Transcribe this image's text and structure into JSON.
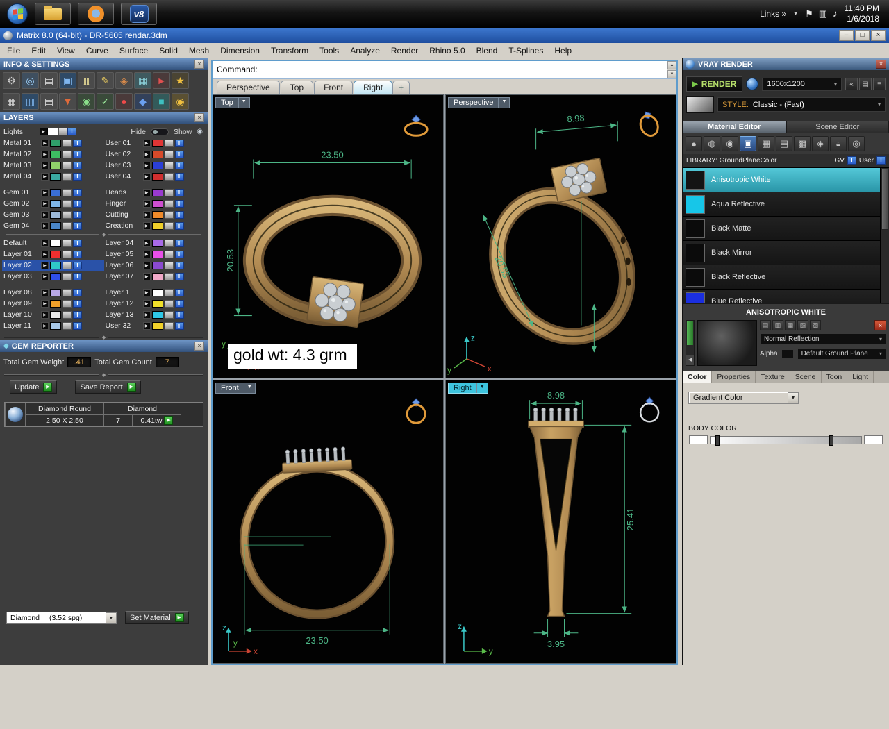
{
  "ui": {
    "chevron_down": "▼",
    "caret_small": "▾",
    "scroll_up": "▲",
    "scroll_down": "▼",
    "layer_arrow": "▶",
    "material_badge": "I",
    "go_arrow": "▶",
    "divider_grip": "◆",
    "links_chevron": "»",
    "close_glyph": "×",
    "eye_glyph": "◉",
    "back_arrow": "◀"
  },
  "taskbar": {
    "links_label": "Links",
    "time": "11:40 PM",
    "date": "1/6/2018",
    "v8_label": "v8",
    "tray_icons": [
      {
        "name": "flag-icon",
        "glyph": "⚑"
      },
      {
        "name": "network-icon",
        "glyph": "▥"
      },
      {
        "name": "volume-icon",
        "glyph": "♪"
      }
    ]
  },
  "window": {
    "title": "Matrix 8.0 (64-bit) - DR-5605 rendar.3dm",
    "btn_min": "–",
    "btn_max": "□",
    "btn_close": "×"
  },
  "menubar": {
    "items": [
      "File",
      "Edit",
      "View",
      "Curve",
      "Surface",
      "Solid",
      "Mesh",
      "Dimension",
      "Transform",
      "Tools",
      "Analyze",
      "Render",
      "Rhino 5.0",
      "Blend",
      "T-Splines",
      "Help"
    ]
  },
  "command": {
    "prompt": "Command:"
  },
  "viewport_tabs": {
    "items": [
      {
        "label": "Perspective"
      },
      {
        "label": "Top"
      },
      {
        "label": "Front"
      },
      {
        "label": "Right",
        "active": true
      }
    ],
    "add_label": "+"
  },
  "info_settings": {
    "title": "INFO & SETTINGS",
    "icons_row1": [
      {
        "name": "gear-icon",
        "glyph": "⚙",
        "fg": "#d0d0d0",
        "bg": "#4a4a4a"
      },
      {
        "name": "search-icon",
        "glyph": "◎",
        "fg": "#9fd4ff",
        "bg": "#3f4f5f"
      },
      {
        "name": "print-icon",
        "glyph": "▤",
        "fg": "#e0e0e0",
        "bg": "#4a4a4a"
      },
      {
        "name": "panels-icon",
        "glyph": "▣",
        "fg": "#7fb6ef",
        "bg": "#2f4a66"
      },
      {
        "name": "notes-icon",
        "glyph": "▥",
        "fg": "#efe29a",
        "bg": "#4a4a4a"
      },
      {
        "name": "edit-pencil-icon",
        "glyph": "✎",
        "fg": "#f0d060",
        "bg": "#4a4a4a"
      },
      {
        "name": "history-icon",
        "glyph": "◈",
        "fg": "#d88a4a",
        "bg": "#4a4a4a"
      },
      {
        "name": "layout-icon",
        "glyph": "▦",
        "fg": "#8ad0d8",
        "bg": "#3f5a5f"
      },
      {
        "name": "play-icon",
        "glyph": "►",
        "fg": "#e05050",
        "bg": "#4a3a3a"
      },
      {
        "name": "star-icon",
        "glyph": "★",
        "fg": "#f0c040",
        "bg": "#4a4433"
      }
    ],
    "icons_row2": [
      {
        "name": "grid-icon",
        "glyph": "▦",
        "fg": "#cfcfcf",
        "bg": "#4a4a4a"
      },
      {
        "name": "viewport-icon",
        "glyph": "▥",
        "fg": "#7fb6ef",
        "bg": "#2f4a66"
      },
      {
        "name": "copy-icon",
        "glyph": "▤",
        "fg": "#e0e0e0",
        "bg": "#4a4a4a"
      },
      {
        "name": "filter-icon",
        "glyph": "▼",
        "fg": "#e06a3a",
        "bg": "#4a4a4a"
      },
      {
        "name": "gumball-icon",
        "glyph": "◉",
        "fg": "#8ae08a",
        "bg": "#3a4a3a"
      },
      {
        "name": "check-icon",
        "glyph": "✓",
        "fg": "#9fef9f",
        "bg": "#3a4a3a"
      },
      {
        "name": "record-icon",
        "glyph": "●",
        "fg": "#ef4a4a",
        "bg": "#4a3a3a"
      },
      {
        "name": "osnap-icon",
        "glyph": "◆",
        "fg": "#6a9fef",
        "bg": "#33415a"
      },
      {
        "name": "cplane-icon",
        "glyph": "■",
        "fg": "#3fc0c0",
        "bg": "#335a5a"
      },
      {
        "name": "sun-icon",
        "glyph": "◉",
        "fg": "#f0c040",
        "bg": "#5a5033"
      }
    ]
  },
  "layers": {
    "title": "LAYERS",
    "lights_name": "Lights",
    "hide_label": "Hide",
    "show_label": "Show",
    "rows_a": [
      {
        "l": {
          "name": "Metal 01",
          "color": "#2f9e6a"
        },
        "r": {
          "name": "User 01",
          "color": "#e03535"
        }
      },
      {
        "l": {
          "name": "Metal 02",
          "color": "#3dbd62"
        },
        "r": {
          "name": "User 02",
          "color": "#d84a2a"
        }
      },
      {
        "l": {
          "name": "Metal 03",
          "color": "#8fd06a"
        },
        "r": {
          "name": "User 03",
          "color": "#2b3fd8"
        }
      },
      {
        "l": {
          "name": "Metal 04",
          "color": "#3aa8a0"
        },
        "r": {
          "name": "User 04",
          "color": "#cf2f2f"
        }
      },
      {
        "l": {
          "name": "Gem 01",
          "color": "#3a6fd8"
        },
        "r": {
          "name": "Heads",
          "color": "#9a3ad0"
        }
      },
      {
        "l": {
          "name": "Gem 02",
          "color": "#7fb6e8"
        },
        "r": {
          "name": "Finger",
          "color": "#cf4fd0"
        }
      },
      {
        "l": {
          "name": "Gem 03",
          "color": "#9db9d8"
        },
        "r": {
          "name": "Cutting",
          "color": "#ef8a2a"
        }
      },
      {
        "l": {
          "name": "Gem 04",
          "color": "#4a86c8"
        },
        "r": {
          "name": "Creation",
          "color": "#efcf2a"
        }
      }
    ],
    "rows_b": [
      {
        "l": {
          "name": "Default",
          "color": "#ffffff"
        },
        "r": {
          "name": "Layer 04",
          "color": "#a86ae8"
        }
      },
      {
        "l": {
          "name": "Layer 01",
          "color": "#ef2f2f"
        },
        "r": {
          "name": "Layer 05",
          "color": "#e84fe8"
        }
      },
      {
        "l": {
          "name": "Layer 02",
          "color": "#2fc8c8",
          "selected": true
        },
        "r": {
          "name": "Layer 06",
          "color": "#8a4ad0"
        }
      },
      {
        "l": {
          "name": "Layer 03",
          "color": "#2f4fe8"
        },
        "r": {
          "name": "Layer 07",
          "color": "#f0a8c8"
        }
      },
      {
        "l": {
          "name": "Layer 08",
          "color": "#b8a8e8"
        },
        "r": {
          "name": "Layer 1",
          "color": "#ffffff"
        }
      },
      {
        "l": {
          "name": "Layer 09",
          "color": "#f0a02a"
        },
        "r": {
          "name": "Layer 12",
          "color": "#f0e02a"
        }
      },
      {
        "l": {
          "name": "Layer 10",
          "color": "#e8e8e8"
        },
        "r": {
          "name": "Layer 13",
          "color": "#2fc8e8"
        }
      },
      {
        "l": {
          "name": "Layer 11",
          "color": "#a8c8e8"
        },
        "r": {
          "name": "User 32",
          "color": "#f0d02a"
        }
      }
    ]
  },
  "gem_reporter": {
    "title": "GEM REPORTER",
    "weight_label": "Total Gem Weight",
    "weight_value": ".41",
    "count_label": "Total Gem Count",
    "count_value": "7",
    "update_label": "Update",
    "save_label": "Save Report",
    "col1": "Diamond Round",
    "col2": "Diamond",
    "cell_size": "2.50 X 2.50",
    "cell_count": "7",
    "cell_weight": "0.41tw",
    "material_value": "Diamond",
    "material_spg": "(3.52 spg)",
    "set_material_label": "Set Material"
  },
  "viewports": {
    "top": {
      "label": "Top",
      "dim_width": "23.50",
      "dim_height": "20.53",
      "annotation": "gold wt: 4.3 grm",
      "axis_x": "x",
      "axis_y": "y"
    },
    "perspective": {
      "label": "Perspective",
      "dim_width": "8.98",
      "dim_diag": "20.53",
      "axis_x": "x",
      "axis_y": "y",
      "axis_z": "z"
    },
    "front": {
      "label": "Front",
      "dim_width": "23.50",
      "axis_x": "x",
      "axis_y": "y",
      "axis_z": "z"
    },
    "right": {
      "label": "Right",
      "dim_width": "8.98",
      "dim_height": "25.41",
      "dim_bottom": "3.95",
      "axis_y": "y",
      "axis_z": "z"
    }
  },
  "vray": {
    "title": "VRAY RENDER",
    "render_label": "RENDER",
    "resolution": "1600x1200",
    "panel_buttons": [
      {
        "name": "dock-left-icon",
        "glyph": "«"
      },
      {
        "name": "panel-icon",
        "glyph": "▤"
      },
      {
        "name": "list-icon",
        "glyph": "≡"
      }
    ],
    "style_label": "STYLE:",
    "style_value": "Classic - (Fast)",
    "editor_tabs": [
      {
        "label": "Material Editor",
        "active": true
      },
      {
        "label": "Scene Editor"
      }
    ],
    "tool_icons": [
      {
        "name": "material-sphere-icon",
        "glyph": "●"
      },
      {
        "name": "material-shaded-icon",
        "glyph": "◍"
      },
      {
        "name": "material-ball-icon",
        "glyph": "◉"
      },
      {
        "name": "material-preview-icon",
        "glyph": "▣",
        "active": true
      },
      {
        "name": "checker-icon",
        "glyph": "▦"
      },
      {
        "name": "grid-texture-icon",
        "glyph": "▤"
      },
      {
        "name": "noise-icon",
        "glyph": "▩"
      },
      {
        "name": "wrap-icon",
        "glyph": "◈"
      },
      {
        "name": "bucket-icon",
        "glyph": "◒"
      },
      {
        "name": "bulb-icon",
        "glyph": "◎"
      }
    ],
    "library_label": "LIBRARY: GroundPlaneColor",
    "gv_label": "GV",
    "user_label": "User",
    "materials": [
      {
        "name": "Anisotropic White",
        "swatch": "#141414",
        "selected": true
      },
      {
        "name": "Aqua Reflective",
        "swatch": "#17c6e8"
      },
      {
        "name": "Black Matte",
        "swatch": "#0b0b0b"
      },
      {
        "name": "Black Mirror",
        "swatch": "#0b0b0b"
      },
      {
        "name": "Black Reflective",
        "swatch": "#0b0b0b"
      },
      {
        "name": "Blue Reflective",
        "swatch": "#1b2fe0"
      }
    ],
    "preview_title": "ANISOTROPIC WHITE",
    "preview_icons": [
      {
        "name": "save-material-icon",
        "glyph": "▤"
      },
      {
        "name": "load-material-icon",
        "glyph": "▥"
      },
      {
        "name": "copy-material-icon",
        "glyph": "▦"
      },
      {
        "name": "paste-material-icon",
        "glyph": "▧"
      },
      {
        "name": "reset-material-icon",
        "glyph": "▨"
      }
    ],
    "delete_glyph": "×",
    "reflection_value": "Normal Reflection",
    "alpha_label": "Alpha",
    "ground_value": "Default Ground Plane",
    "bottom_tabs": [
      {
        "label": "Color",
        "active": true
      },
      {
        "label": "Properties"
      },
      {
        "label": "Texture"
      },
      {
        "label": "Scene"
      },
      {
        "label": "Toon"
      },
      {
        "label": "Light"
      }
    ],
    "gradient_value": "Gradient Color",
    "body_color_label": "BODY COLOR"
  }
}
